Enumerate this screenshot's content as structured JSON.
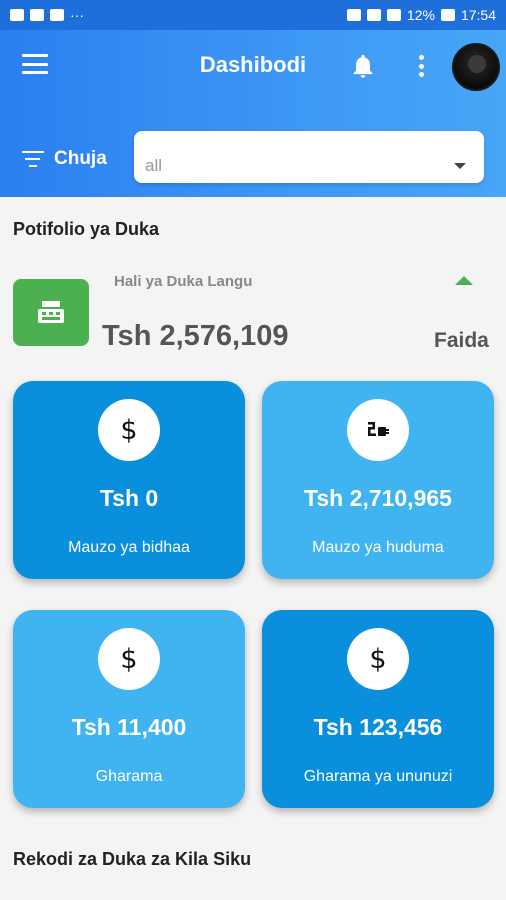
{
  "status_bar": {
    "battery": "12%",
    "time": "17:54"
  },
  "header": {
    "title": "Dashibodi"
  },
  "filter": {
    "label": "Chuja",
    "value": "all"
  },
  "portfolio": {
    "section_title": "Potifolio ya Duka",
    "status_label": "Hali ya Duka Langu",
    "total_value": "Tsh 2,576,109",
    "profit_label": "Faida"
  },
  "cards": [
    {
      "value": "Tsh 0",
      "label": "Mauzo ya bidhaa",
      "icon": "dollar-icon"
    },
    {
      "value": "Tsh 2,710,965",
      "label": "Mauzo ya huduma",
      "icon": "service-icon"
    },
    {
      "value": "Tsh 11,400",
      "label": "Gharama",
      "icon": "dollar-icon"
    },
    {
      "value": "Tsh 123,456",
      "label": "Gharama ya ununuzi",
      "icon": "dollar-icon"
    }
  ],
  "daily_records": {
    "section_title": "Rekodi za Duka za Kila Siku"
  },
  "colors": {
    "header_start": "#2b7ff0",
    "header_end": "#47a6f6",
    "card_dark": "#0a8fdc",
    "card_light": "#3fb4f0",
    "shop_icon_bg": "#4caf50"
  }
}
